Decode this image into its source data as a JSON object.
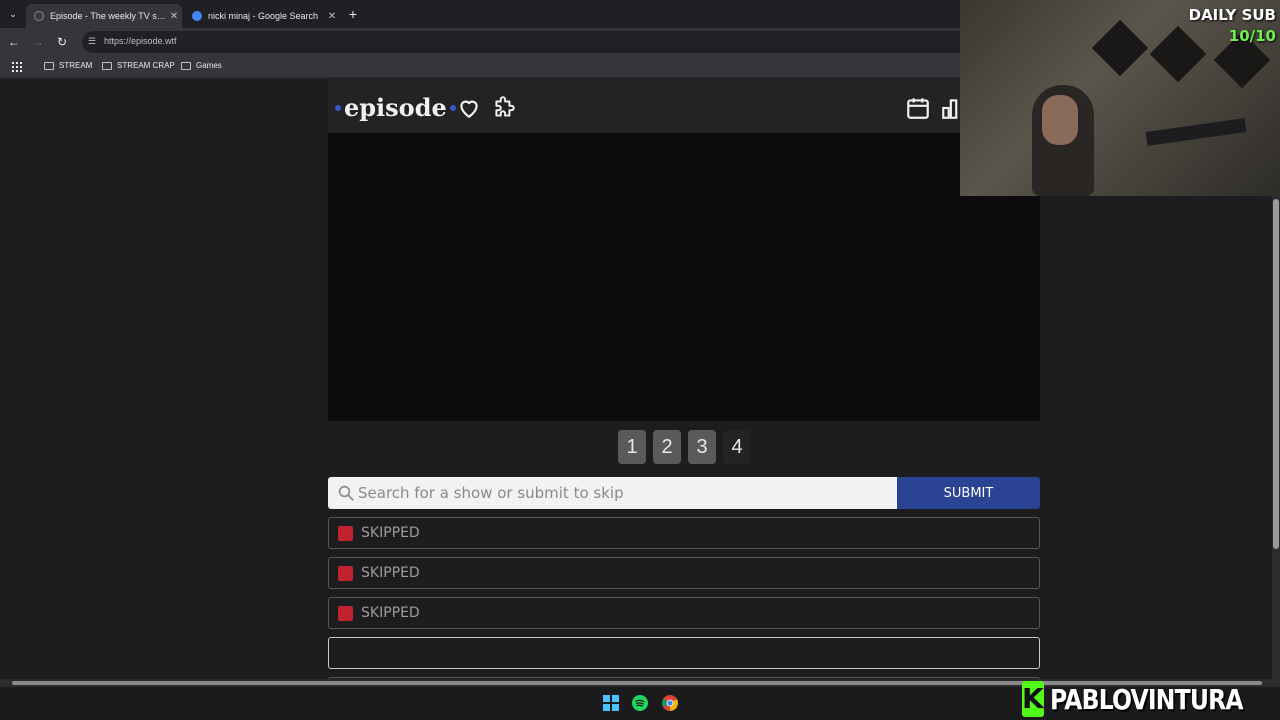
{
  "browser": {
    "tabs": [
      {
        "title": "Episode - The weekly TV show g",
        "active": true,
        "favicon_color": "#3a3a3a"
      },
      {
        "title": "nicki minaj - Google Search",
        "active": false,
        "favicon_color": "#4285f4"
      }
    ],
    "new_tab": "+",
    "url": "https://episode.wtf",
    "bookmarks": [
      "STREAM",
      "STREAM CRAP",
      "Games"
    ]
  },
  "site": {
    "logo": "episode",
    "accent_color": "#2b4393",
    "step_numbers": [
      "1",
      "2",
      "3",
      "4"
    ],
    "current_step": 4,
    "search": {
      "placeholder": "Search for a show or submit to skip",
      "value": ""
    },
    "submit_label": "SUBMIT",
    "guesses": [
      {
        "label": "SKIPPED",
        "status_color": "#c0232f"
      },
      {
        "label": "SKIPPED",
        "status_color": "#c0232f"
      },
      {
        "label": "SKIPPED",
        "status_color": "#c0232f"
      },
      {
        "label": "",
        "status_color": ""
      }
    ]
  },
  "overlay": {
    "daily_sub_label": "DAILY SUB",
    "daily_sub_count": "10/10",
    "brand_name": "PABLOVINTURA",
    "brand_letter": "K",
    "brand_color": "#53fc18"
  },
  "taskbar": {
    "icons": [
      "windows-start-icon",
      "spotify-icon",
      "chrome-icon"
    ]
  }
}
